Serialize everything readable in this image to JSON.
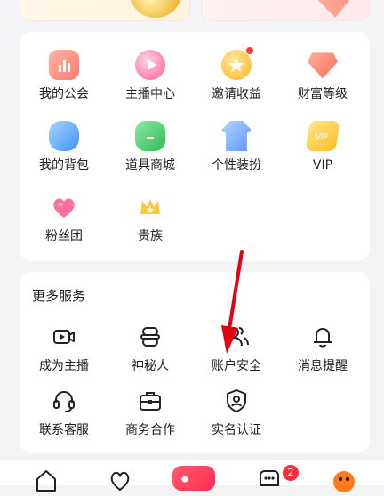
{
  "features": {
    "items": [
      {
        "label": "我的公会",
        "icon": "guild-icon",
        "color": "#ff8a7a"
      },
      {
        "label": "主播中心",
        "icon": "anchor-center-icon",
        "color": "#ff6fa8"
      },
      {
        "label": "邀请收益",
        "icon": "invite-income-icon",
        "color": "#ffc63a",
        "badge": true
      },
      {
        "label": "财富等级",
        "icon": "wealth-level-icon",
        "color": "#ff7f6a"
      },
      {
        "label": "我的背包",
        "icon": "backpack-icon",
        "color": "#5aa8ff"
      },
      {
        "label": "道具商城",
        "icon": "prop-store-icon",
        "color": "#47c96c"
      },
      {
        "label": "个性装扮",
        "icon": "costume-icon",
        "color": "#6aa4ff"
      },
      {
        "label": "VIP",
        "icon": "vip-icon",
        "color": "#ffd24a"
      },
      {
        "label": "粉丝团",
        "icon": "fan-club-icon",
        "color": "#ff7ba5"
      },
      {
        "label": "贵族",
        "icon": "noble-icon",
        "color": "#ffc738"
      }
    ]
  },
  "more_services": {
    "title": "更多服务",
    "items": [
      {
        "label": "成为主播",
        "icon": "video-camera-icon"
      },
      {
        "label": "神秘人",
        "icon": "mystery-person-icon"
      },
      {
        "label": "账户安全",
        "icon": "account-security-icon"
      },
      {
        "label": "消息提醒",
        "icon": "bell-icon"
      },
      {
        "label": "联系客服",
        "icon": "headset-icon"
      },
      {
        "label": "商务合作",
        "icon": "briefcase-icon"
      },
      {
        "label": "实名认证",
        "icon": "id-verify-icon"
      }
    ]
  },
  "tabbar": {
    "badge": "2",
    "tabs": [
      "home-icon",
      "heart-icon",
      "live-icon",
      "message-icon",
      "avatar-icon"
    ]
  }
}
